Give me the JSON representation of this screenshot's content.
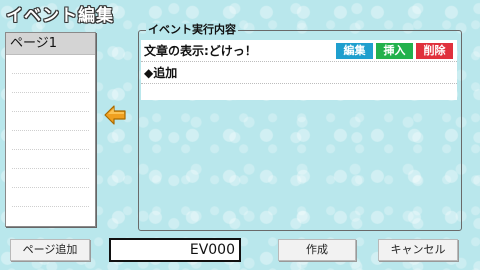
{
  "window": {
    "title": "イベント編集"
  },
  "pages": {
    "items": [
      {
        "label": "ページ1",
        "selected": true
      }
    ]
  },
  "event_panel": {
    "title": "イベント実行内容",
    "rows": [
      {
        "text": "文章の表示:どけっ！",
        "actions": {
          "edit": "編集",
          "insert": "挿入",
          "delete": "削除"
        }
      },
      {
        "text": "◆追加"
      }
    ]
  },
  "arrow": {
    "icon": "arrow-left-icon",
    "color": "#f0a020"
  },
  "footer": {
    "add_page": "ページ追加",
    "event_id": "EV000",
    "create": "作成",
    "cancel": "キャンセル"
  },
  "colors": {
    "background": "#b9e7ec",
    "edit": "#1f9fce",
    "insert": "#22b14c",
    "delete": "#e0303c"
  }
}
